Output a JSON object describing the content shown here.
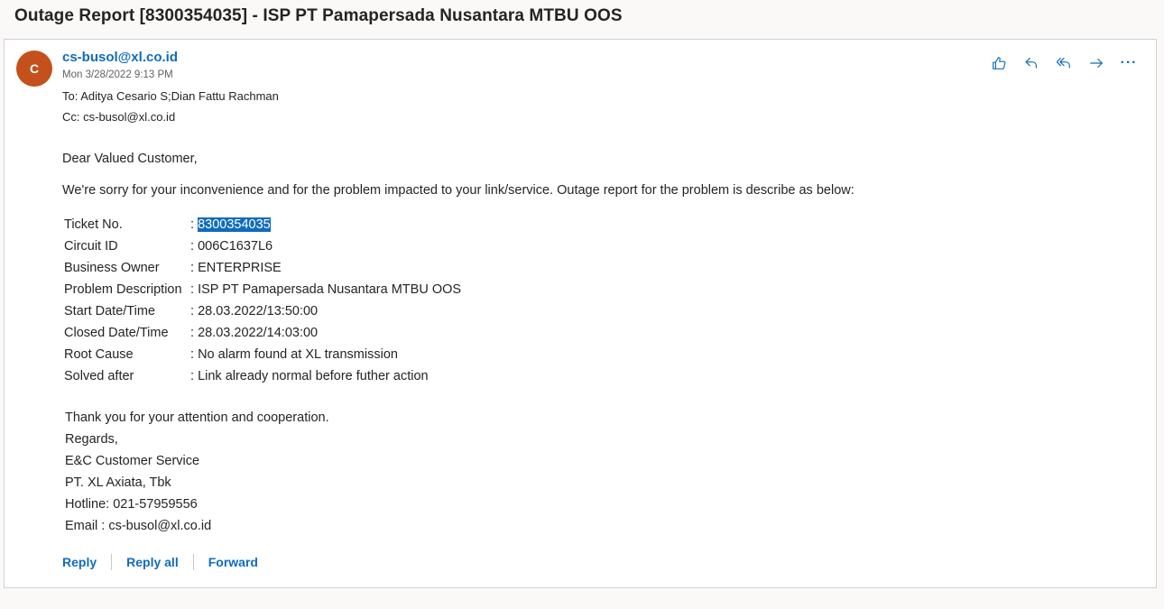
{
  "subject": "Outage Report [8300354035] - ISP PT Pamapersada Nusantara MTBU OOS",
  "message": {
    "avatar_initial": "C",
    "from": "cs-busol@xl.co.id",
    "date": "Mon 3/28/2022 9:13 PM",
    "to": "To: Aditya Cesario S;Dian Fattu Rachman",
    "cc": "Cc: cs-busol@xl.co.id"
  },
  "actions": {
    "like_icon": "thumbs-up-icon",
    "reply_icon": "reply-icon",
    "reply_all_icon": "reply-all-icon",
    "forward_icon": "forward-icon",
    "more_label": "···"
  },
  "body": {
    "greeting": "Dear Valued Customer,",
    "intro": "We're sorry for your inconvenience and for the problem impacted to your link/service. Outage report for the problem is describe as below:",
    "details": [
      {
        "label": "Ticket No.",
        "sep": ": ",
        "value": "8300354035"
      },
      {
        "label": "Circuit ID",
        "sep": ": ",
        "value": "006C1637L6"
      },
      {
        "label": "Business Owner",
        "sep": ": ",
        "value": "ENTERPRISE"
      },
      {
        "label": "Problem Description",
        "sep": ": ",
        "value": "ISP PT Pamapersada Nusantara MTBU OOS"
      },
      {
        "label": "Start Date/Time",
        "sep": ": ",
        "value": "28.03.2022/13:50:00"
      },
      {
        "label": "Closed Date/Time",
        "sep": ": ",
        "value": "28.03.2022/14:03:00"
      },
      {
        "label": "Root Cause",
        "sep": ": ",
        "value": "No alarm found at XL transmission"
      },
      {
        "label": "Solved after",
        "sep": ": ",
        "value": "Link already normal before futher action"
      }
    ],
    "closing": [
      "Thank you for your attention and cooperation.",
      "Regards,",
      "E&C Customer Service",
      "PT. XL Axiata, Tbk",
      "Hotline: 021-57959556",
      "Email : cs-busol@xl.co.id"
    ]
  },
  "footer": {
    "reply": "Reply",
    "reply_all": "Reply all",
    "forward": "Forward"
  },
  "colors": {
    "accent": "#0f6cbd",
    "avatar": "#c4511b"
  }
}
